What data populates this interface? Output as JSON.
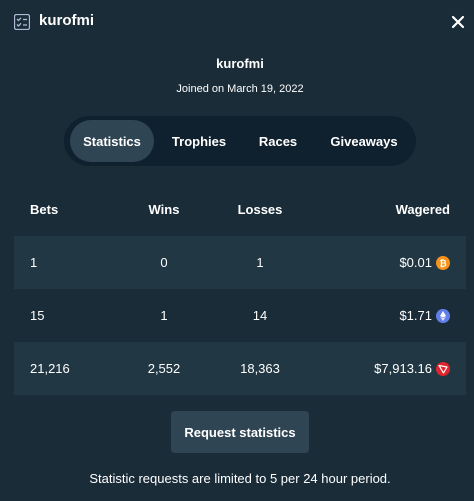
{
  "header": {
    "title": "kurofmi",
    "icon": "stats-list-icon",
    "close_icon": "close-icon"
  },
  "profile": {
    "username": "kurofmi",
    "joined": "Joined on March 19, 2022"
  },
  "tabs": [
    {
      "label": "Statistics",
      "active": true
    },
    {
      "label": "Trophies",
      "active": false
    },
    {
      "label": "Races",
      "active": false
    },
    {
      "label": "Giveaways",
      "active": false
    }
  ],
  "table": {
    "columns": [
      "Bets",
      "Wins",
      "Losses",
      "Wagered"
    ],
    "rows": [
      {
        "bets": "1",
        "wins": "0",
        "losses": "1",
        "wagered": "$0.01",
        "currency_icon": "bitcoin-icon",
        "currency_color": "#f7931a"
      },
      {
        "bets": "15",
        "wins": "1",
        "losses": "14",
        "wagered": "$1.71",
        "currency_icon": "ethereum-icon",
        "currency_color": "#627eea"
      },
      {
        "bets": "21,216",
        "wins": "2,552",
        "losses": "18,363",
        "wagered": "$7,913.16",
        "currency_icon": "tron-icon",
        "currency_color": "#e0242d"
      }
    ]
  },
  "request_button": "Request statistics",
  "note": "Statistic requests are limited to 5 per 24 hour period.",
  "colors": {
    "background": "#1a2c38",
    "tab_track": "#0f212e",
    "active_tab": "#2f4553",
    "row_shade": "#213743",
    "button": "#2f4553"
  }
}
